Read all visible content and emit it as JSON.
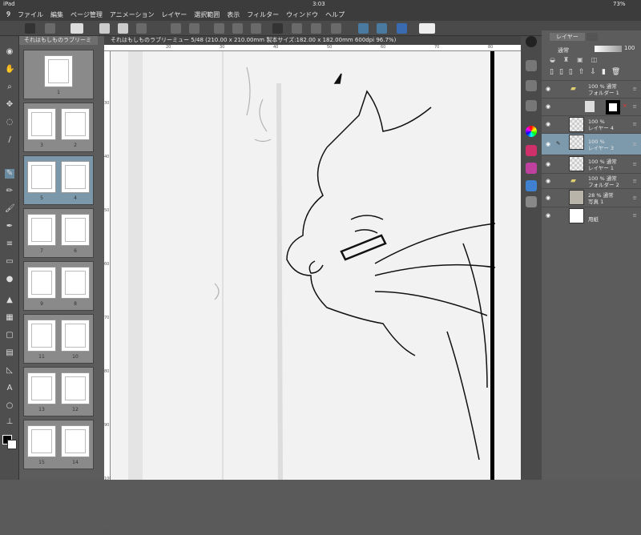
{
  "status": {
    "device": "iPad",
    "time": "3:03",
    "battery": "73%"
  },
  "menu": [
    "ファイル",
    "編集",
    "ページ管理",
    "アニメーション",
    "レイヤー",
    "選択範囲",
    "表示",
    "フィルター",
    "ウィンドウ",
    "ヘルプ"
  ],
  "pages_panel": {
    "tab": "それはもしものラブリーミ",
    "spreads": [
      [
        "",
        "1"
      ],
      [
        "3",
        "2"
      ],
      [
        "5",
        "4"
      ],
      [
        "7",
        "6"
      ],
      [
        "9",
        "8"
      ],
      [
        "11",
        "10"
      ],
      [
        "13",
        "12"
      ],
      [
        "15",
        "14"
      ]
    ],
    "selected_spread": 2
  },
  "canvas": {
    "tab": "それはもしものラブリーミュー 5/48 (210.00 x 210.00mm 製本サイズ:182.00 x 182.00mm 600dpi 96.7%)",
    "ruler_top": [
      "20",
      "30",
      "40",
      "50",
      "60",
      "70",
      "80"
    ],
    "ruler_left": [
      "30",
      "40",
      "50",
      "60",
      "70",
      "80",
      "90",
      "100",
      "110"
    ]
  },
  "layers_panel": {
    "tab": "レイヤー",
    "blend_mode": "通常",
    "opacity": "100",
    "layers": [
      {
        "line1": "100 % 通常",
        "line2": "フォルダー 1",
        "type": "folder",
        "expanded": true
      },
      {
        "line1": "",
        "line2": "",
        "type": "mask"
      },
      {
        "line1": "100 %",
        "line2": "レイヤー 4",
        "type": "layer"
      },
      {
        "line1": "100 %",
        "line2": "レイヤー 3",
        "type": "layer",
        "selected": true
      },
      {
        "line1": "100 % 通常",
        "line2": "レイヤー 1",
        "type": "layer"
      },
      {
        "line1": "100 % 通常",
        "line2": "フォルダー 2",
        "type": "folder"
      },
      {
        "line1": "28 % 通常",
        "line2": "写真 1",
        "type": "photo"
      },
      {
        "line1": "",
        "line2": "用紙",
        "type": "paper"
      }
    ]
  },
  "colors": {
    "accent": "#7c9aab",
    "main_color": "#000000",
    "sub_color": "#ffffff"
  }
}
